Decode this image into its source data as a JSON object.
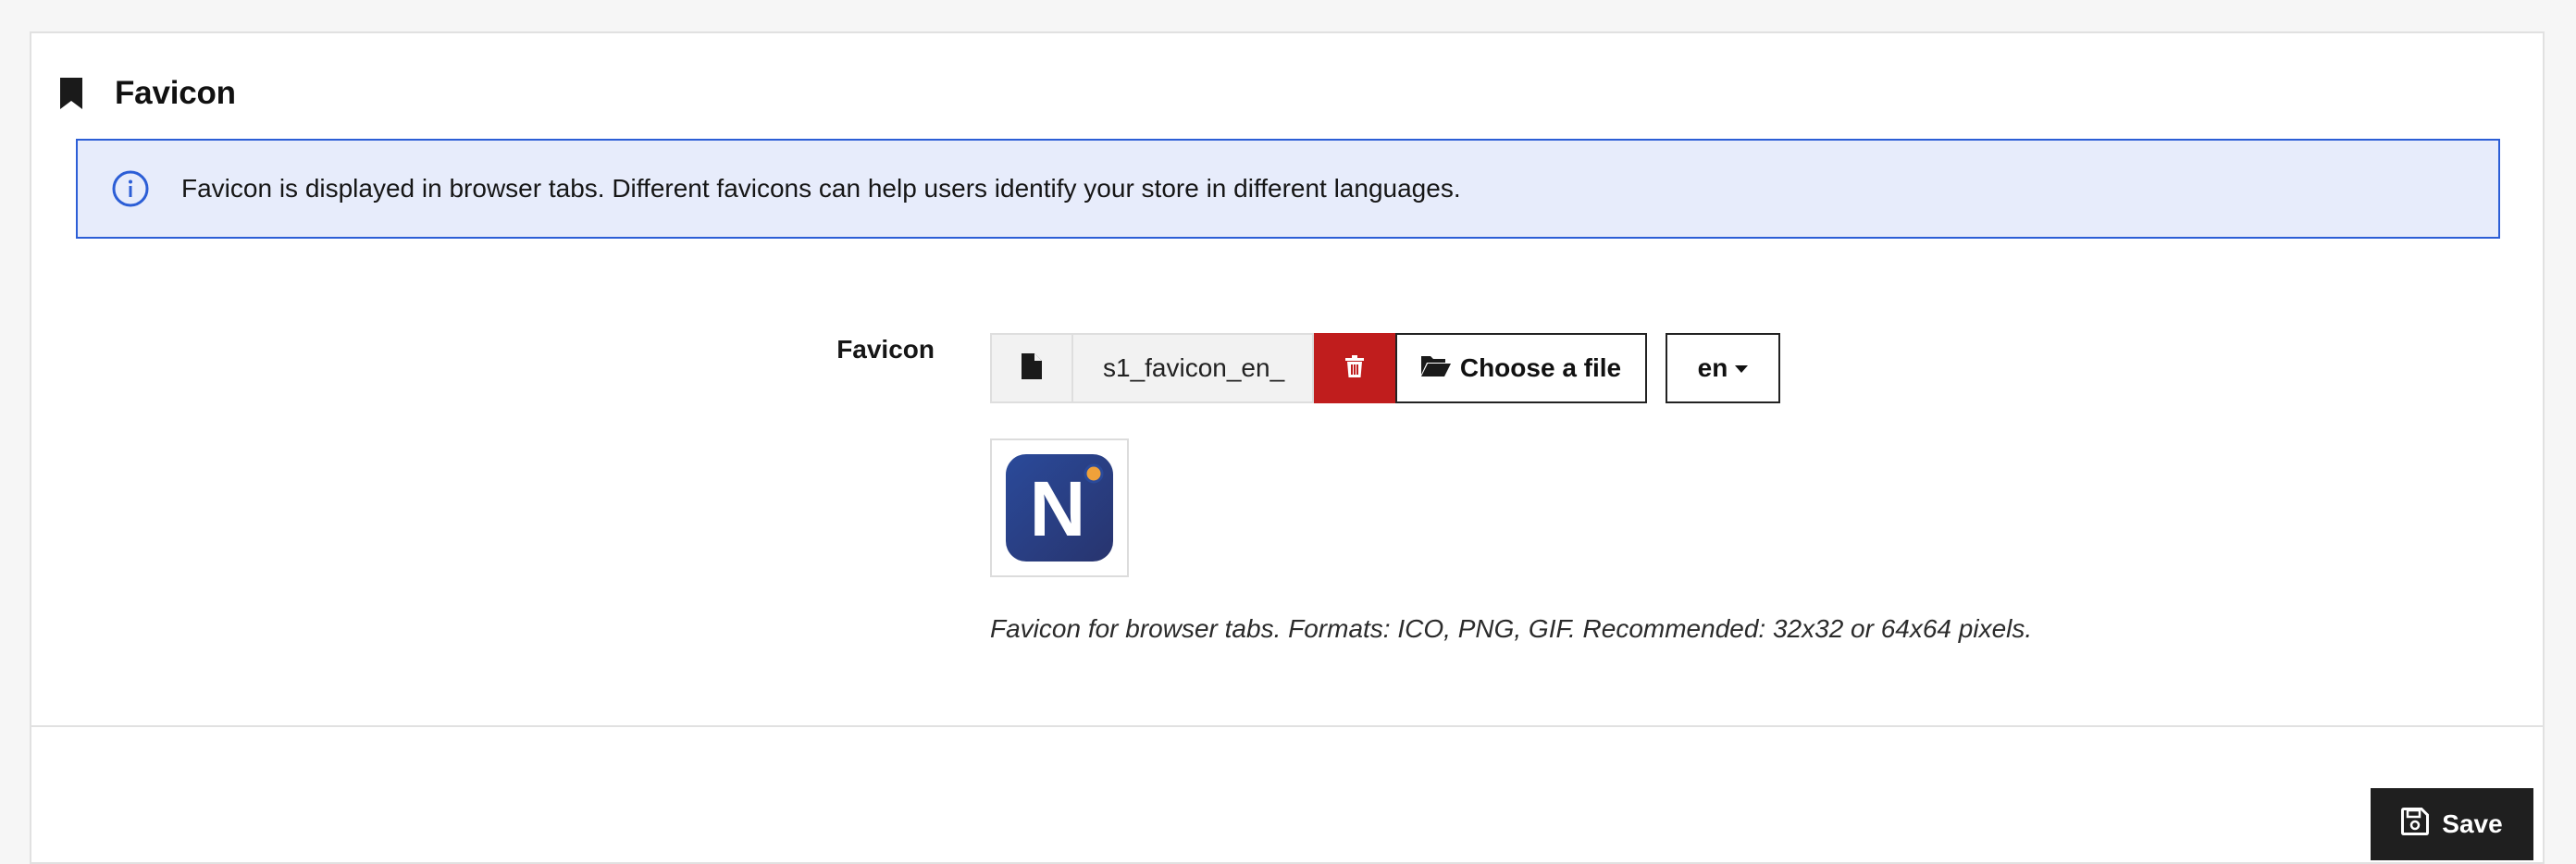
{
  "section": {
    "title": "Favicon",
    "icon": "bookmark-icon"
  },
  "info": {
    "icon": "info-circle-icon",
    "text": "Favicon is displayed in browser tabs. Different favicons can help users identify your store in different languages."
  },
  "favicon_field": {
    "label": "Favicon",
    "file_icon": "file-icon",
    "file_name": "s1_favicon_en_",
    "delete_icon": "trash-icon",
    "choose_label": "Choose a file",
    "choose_icon": "folder-open-icon",
    "language": "en",
    "preview_letter": "N",
    "help_text": "Favicon for browser tabs. Formats: ICO, PNG, GIF. Recommended: 32x32 or 64x64 pixels."
  },
  "footer": {
    "save_label": "Save",
    "save_icon": "floppy-disk-icon"
  },
  "colors": {
    "info_bg": "#e7ecfb",
    "info_border": "#2c5ed6",
    "delete_bg": "#c01d1d",
    "save_bg": "#1f1f1f",
    "favicon_bg": "#2a3f8a",
    "favicon_dot": "#f0a13a"
  }
}
